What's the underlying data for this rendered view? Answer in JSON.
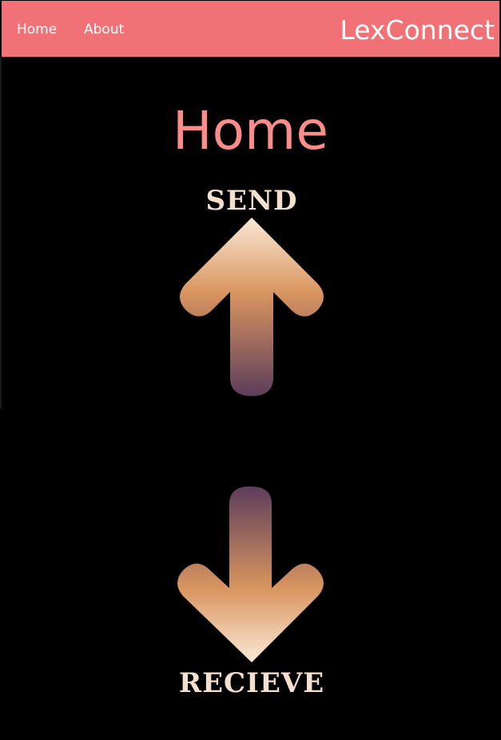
{
  "navbar": {
    "links": [
      {
        "label": "Home"
      },
      {
        "label": "About"
      }
    ],
    "brand": "LexConnect",
    "background_color": "#f07276"
  },
  "main": {
    "title": "Home",
    "title_color": "#fa8c89",
    "actions": [
      {
        "label": "SEND",
        "icon": "arrow-up-icon"
      },
      {
        "label": "RECIEVE",
        "icon": "arrow-down-icon"
      }
    ]
  },
  "colors": {
    "page_background": "#000000",
    "arrow_gradient": [
      "#fbe9d6",
      "#d9955f",
      "#5d3d5c"
    ]
  }
}
